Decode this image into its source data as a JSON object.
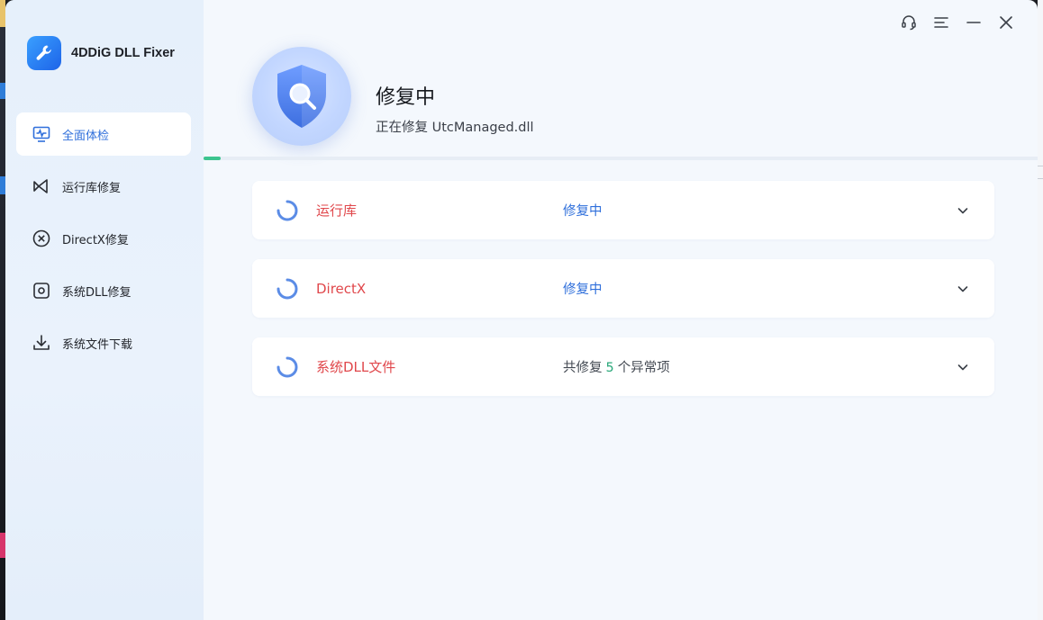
{
  "app": {
    "name": "4DDiG DLL Fixer"
  },
  "sidebar": {
    "items": [
      {
        "label": "全面体检",
        "icon": "monitor-pulse-icon",
        "active": true
      },
      {
        "label": "运行库修复",
        "icon": "runtime-icon",
        "active": false
      },
      {
        "label": "DirectX修复",
        "icon": "directx-icon",
        "active": false
      },
      {
        "label": "系统DLL修复",
        "icon": "dll-gear-icon",
        "active": false
      },
      {
        "label": "系统文件下载",
        "icon": "download-icon",
        "active": false
      }
    ]
  },
  "window_controls": [
    "support-headset-icon",
    "menu-icon",
    "minimize-icon",
    "close-icon"
  ],
  "header": {
    "title": "修复中",
    "subtitle": "正在修复 UtcManaged.dll",
    "progress_fraction": 0.02
  },
  "cards": [
    {
      "name": "运行库",
      "status": "修复中"
    },
    {
      "name": "DirectX",
      "status": "修复中"
    },
    {
      "name": "系统DLL文件",
      "status_prefix": "共修复",
      "status_count": "5",
      "status_suffix": "个异常项"
    }
  ],
  "colors": {
    "accent": "#2f6fdb",
    "error_name": "#e0474b",
    "count_green": "#2aa87a",
    "progress": "#3cc48f"
  }
}
